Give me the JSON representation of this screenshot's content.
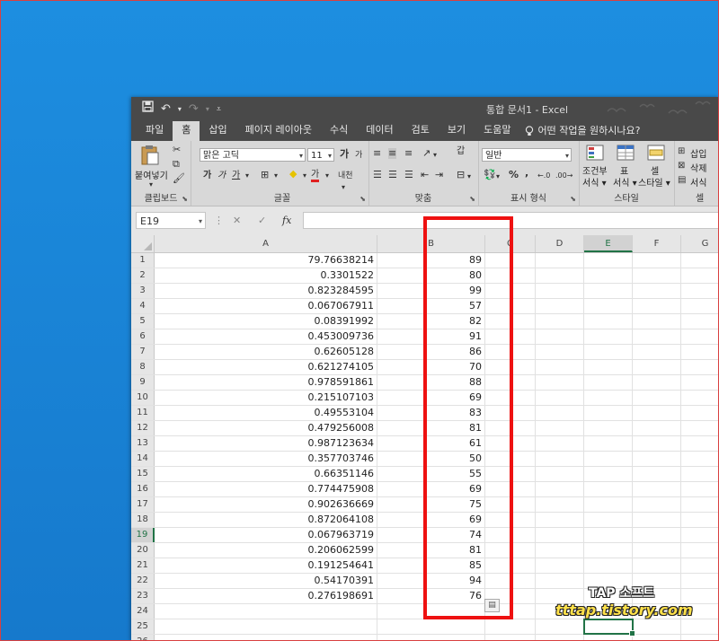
{
  "window": {
    "title": "통합 문서1  -  Excel"
  },
  "qat": {
    "save_icon": "save-icon",
    "undo_icon": "undo-icon",
    "redo_icon": "redo-icon",
    "customize_icon": "customize-qat-icon"
  },
  "tabs": [
    "파일",
    "홈",
    "삽입",
    "페이지 레이아웃",
    "수식",
    "데이터",
    "검토",
    "보기",
    "도움말"
  ],
  "tellme": "어떤 작업을 원하시나요?",
  "ribbon": {
    "clipboard": {
      "paste_label": "붙여넣기",
      "group_label": "클립보드"
    },
    "font": {
      "font_name": "맑은 고딕",
      "font_size": "11",
      "group_label": "글꼴",
      "grow": "가",
      "shrink": "가",
      "bold": "가",
      "italic": "가",
      "underline": "가",
      "font_color": "가",
      "phonetic": "내천"
    },
    "alignment": {
      "group_label": "맞춤",
      "wrap": "갑"
    },
    "number": {
      "format": "일반",
      "group_label": "표시 형식",
      "percent": "%",
      "comma": ","
    },
    "styles": {
      "group_label": "스타일",
      "conditional": "조건부",
      "conditional2": "서식 ▾",
      "table": "표",
      "table2": "서식 ▾",
      "cell": "셀",
      "cell2": "스타일 ▾"
    },
    "cells": {
      "group_label": "셀",
      "insert": "삽입",
      "delete": "삭제",
      "format": "서식"
    }
  },
  "formula_bar": {
    "name_box": "E19",
    "fx": "fx",
    "value": ""
  },
  "columns": [
    "A",
    "B",
    "C",
    "D",
    "E",
    "F",
    "G"
  ],
  "active_column": "E",
  "active_row": 19,
  "rows": [
    {
      "n": "1",
      "a": "79.76638214",
      "b": "89"
    },
    {
      "n": "2",
      "a": "0.3301522",
      "b": "80"
    },
    {
      "n": "3",
      "a": "0.823284595",
      "b": "99"
    },
    {
      "n": "4",
      "a": "0.067067911",
      "b": "57"
    },
    {
      "n": "5",
      "a": "0.08391992",
      "b": "82"
    },
    {
      "n": "6",
      "a": "0.453009736",
      "b": "91"
    },
    {
      "n": "7",
      "a": "0.62605128",
      "b": "86"
    },
    {
      "n": "8",
      "a": "0.621274105",
      "b": "70"
    },
    {
      "n": "9",
      "a": "0.978591861",
      "b": "88"
    },
    {
      "n": "10",
      "a": "0.215107103",
      "b": "69"
    },
    {
      "n": "11",
      "a": "0.49553104",
      "b": "83"
    },
    {
      "n": "12",
      "a": "0.479256008",
      "b": "81"
    },
    {
      "n": "13",
      "a": "0.987123634",
      "b": "61"
    },
    {
      "n": "14",
      "a": "0.357703746",
      "b": "50"
    },
    {
      "n": "15",
      "a": "0.66351146",
      "b": "55"
    },
    {
      "n": "16",
      "a": "0.774475908",
      "b": "69"
    },
    {
      "n": "17",
      "a": "0.902636669",
      "b": "75"
    },
    {
      "n": "18",
      "a": "0.872064108",
      "b": "69"
    },
    {
      "n": "19",
      "a": "0.067963719",
      "b": "74"
    },
    {
      "n": "20",
      "a": "0.206062599",
      "b": "81"
    },
    {
      "n": "21",
      "a": "0.191254641",
      "b": "85"
    },
    {
      "n": "22",
      "a": "0.54170391",
      "b": "94"
    },
    {
      "n": "23",
      "a": "0.276198691",
      "b": "76"
    },
    {
      "n": "24",
      "a": "",
      "b": ""
    },
    {
      "n": "25",
      "a": "",
      "b": ""
    },
    {
      "n": "26",
      "a": "",
      "b": ""
    }
  ],
  "watermark": {
    "line1": "TAP 소프트",
    "line2": "tttap.tistory.com"
  },
  "colors": {
    "excel_green": "#217346",
    "highlight_red": "#ee1111",
    "desktop_blue": "#1a86d8"
  }
}
